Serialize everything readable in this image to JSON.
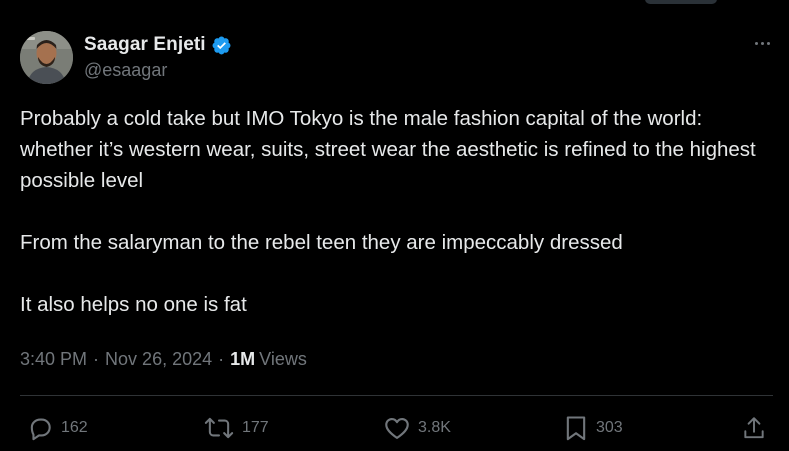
{
  "author": {
    "name": "Saagar Enjeti",
    "handle": "@esaagar",
    "verified": true,
    "verified_color": "#1d9bf0"
  },
  "tweet": {
    "paragraphs": [
      "Probably a cold take but IMO Tokyo is the male fashion capital of the world: whether it’s western wear, suits, street wear the aesthetic is refined to the highest possible level",
      "From the salaryman to the rebel teen they are impeccably dressed",
      "It also helps no one is fat"
    ]
  },
  "meta": {
    "time": "3:40 PM",
    "separator": "·",
    "date": "Nov 26, 2024",
    "views_count": "1M",
    "views_label": "Views"
  },
  "actions": {
    "replies": "162",
    "reposts": "177",
    "likes": "3.8K",
    "bookmarks": "303"
  },
  "icons": {
    "more": "more-horizontal-icon",
    "reply": "reply-icon",
    "repost": "repost-icon",
    "like": "heart-icon",
    "bookmark": "bookmark-icon",
    "share": "share-icon",
    "verified": "verified-badge-icon"
  },
  "colors": {
    "background": "#000000",
    "text_primary": "#e7e9ea",
    "text_secondary": "#71767b",
    "divider": "#2f3336"
  }
}
